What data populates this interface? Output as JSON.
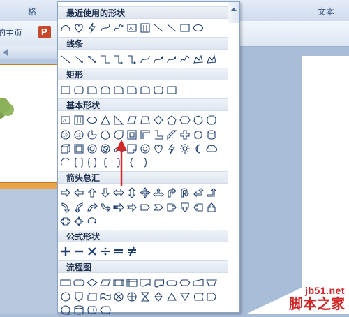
{
  "background": {
    "ribbon_tab_right": "文本",
    "home_tab": "的主页",
    "ppt_letter": "P"
  },
  "gallery": {
    "sections": [
      {
        "key": "recent",
        "title": "最近使用的形状"
      },
      {
        "key": "lines",
        "title": "线条"
      },
      {
        "key": "rect",
        "title": "矩形"
      },
      {
        "key": "basic",
        "title": "基本形状"
      },
      {
        "key": "arrows",
        "title": "箭头总汇"
      },
      {
        "key": "equation",
        "title": "公式形状"
      },
      {
        "key": "flowchart",
        "title": "流程图"
      }
    ],
    "highlighted_shape": "block-arc-icon"
  },
  "watermark": {
    "url": "jb51.net",
    "text": "脚本之家"
  },
  "colors": {
    "accent_red": "#d02828",
    "shape_stroke": "#1f3f6e",
    "header_bg": "#e4eaf2"
  }
}
